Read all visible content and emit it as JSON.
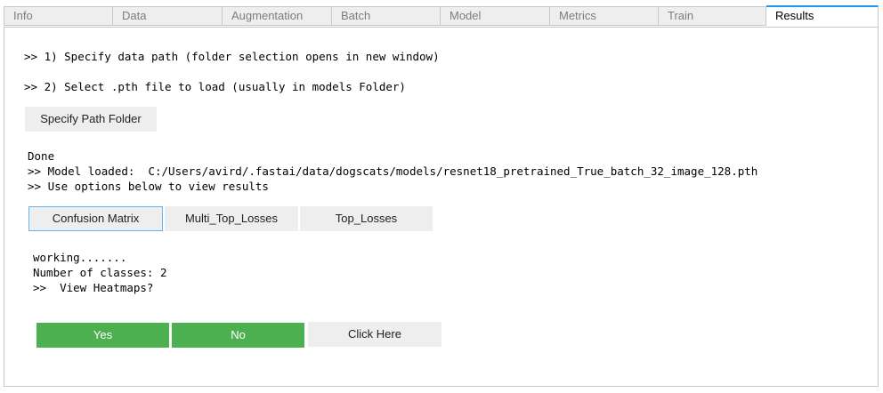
{
  "tabs": [
    {
      "label": "Info"
    },
    {
      "label": "Data"
    },
    {
      "label": "Augmentation"
    },
    {
      "label": "Batch"
    },
    {
      "label": "Model"
    },
    {
      "label": "Metrics"
    },
    {
      "label": "Train"
    },
    {
      "label": "Results"
    }
  ],
  "active_tab": "Results",
  "instructions": {
    "step1": ">> 1) Specify data path (folder selection opens in new window)",
    "step2": ">> 2) Select .pth file to load (usually in models Folder)"
  },
  "specify_button": "Specify Path Folder",
  "status": {
    "done": "Done",
    "model_loaded": ">> Model loaded:  C:/Users/avird/.fastai/data/dogscats/models/resnet18_pretrained_True_batch_32_image_128.pth",
    "use_options": ">> Use options below to view results"
  },
  "result_buttons": {
    "confusion_matrix": "Confusion Matrix",
    "multi_top_losses": "Multi_Top_Losses",
    "top_losses": "Top_Losses"
  },
  "output": {
    "working": "working.......",
    "num_classes": "Number of classes: 2",
    "heatmaps_prompt": ">>  View Heatmaps?"
  },
  "heatmap_buttons": {
    "yes": "Yes",
    "no": "No",
    "click_here": "Click Here"
  },
  "colors": {
    "accent": "#2196f3",
    "green_button": "#4caf50",
    "button_gray": "#eeeeee",
    "selected_border": "#64b5f6"
  }
}
